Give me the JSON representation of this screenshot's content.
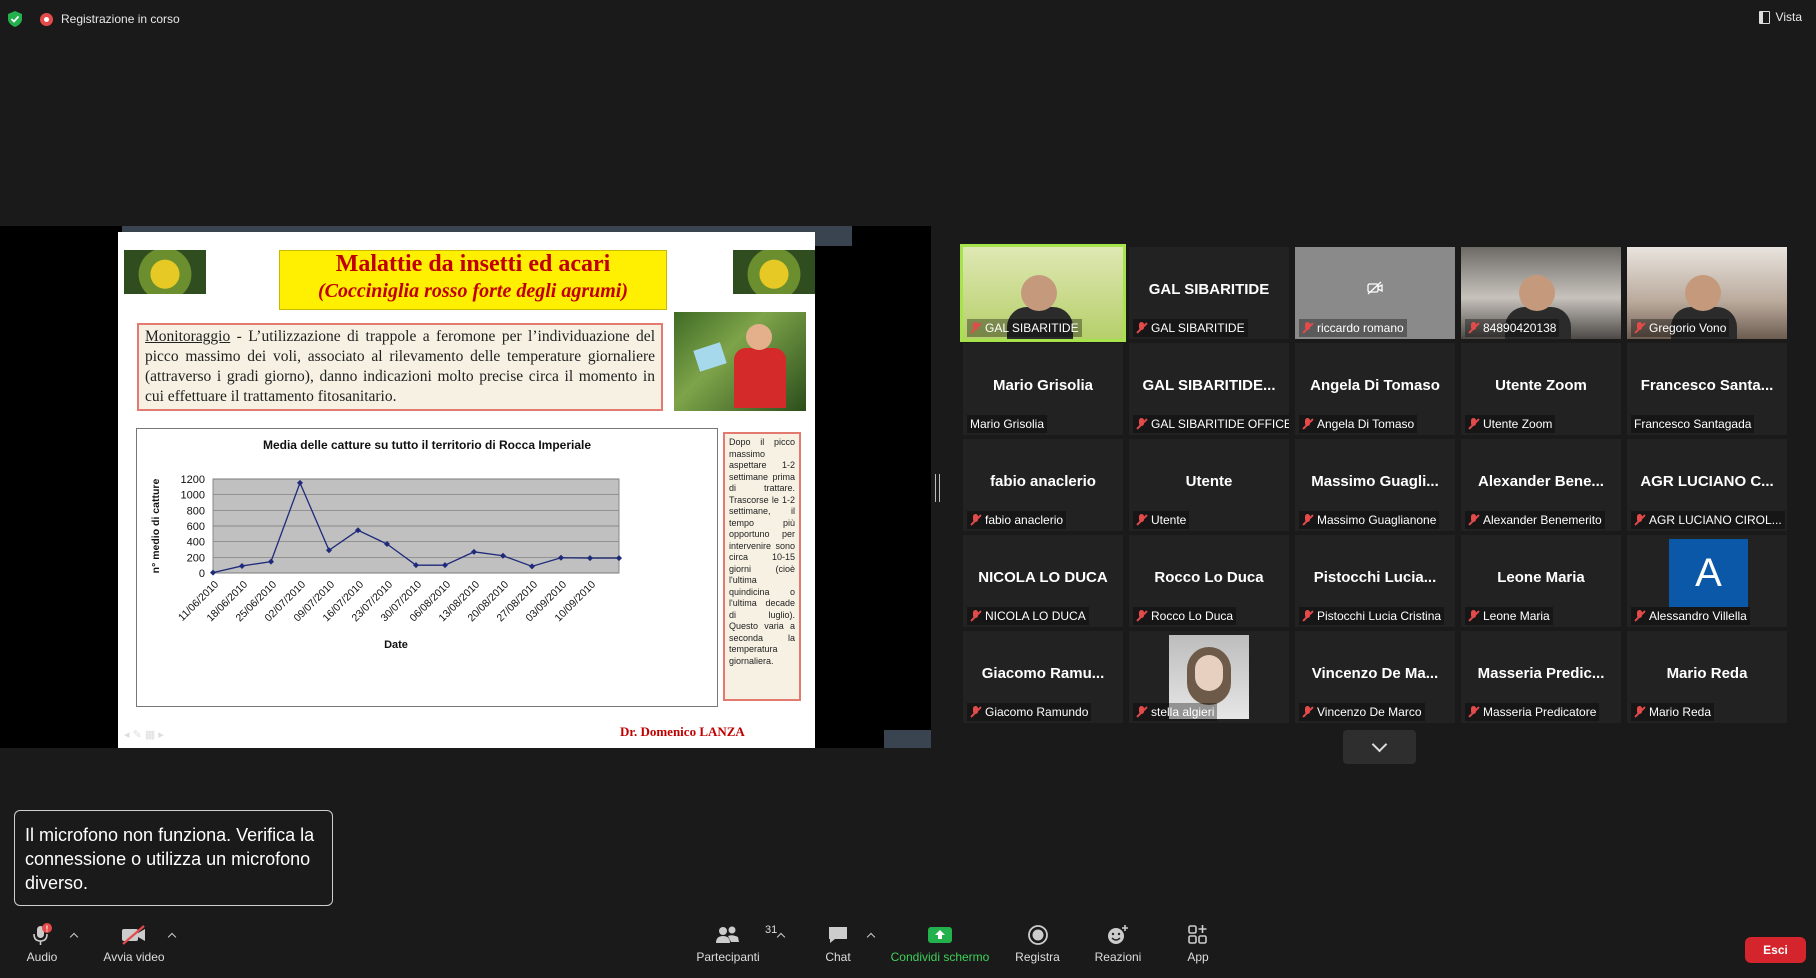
{
  "topbar": {
    "recording_label": "Registrazione in corso",
    "view_label": "Vista"
  },
  "slide": {
    "title_line1": "Malattie da insetti ed acari",
    "title_line2": "(Cocciniglia rosso forte degli agrumi)",
    "monitor_label": "Monitoraggio",
    "monitor_text": " - L’utilizzazione di trappole a feromone per l’individuazione del picco massimo dei voli, associato al rilevamento delle temperature giornaliere (attraverso i gradi giorno), danno indicazioni molto precise circa il momento in cui effettuare il trattamento fitosanitario.",
    "side_note": "Dopo il picco massimo aspettare 1-2 settimane prima di trattare. Trascorse le 1-2 settimane, il tempo più opportuno per intervenire sono circa 10-15 giorni (cioè l'ultima quindicina o l'ultima decade di luglio). Questo varia a seconda la temperatura giornaliera.",
    "author": "Dr. Domenico LANZA"
  },
  "chart_data": {
    "type": "line",
    "title": "Media delle catture su tutto il territorio di Rocca Imperiale",
    "xlabel": "Date",
    "ylabel": "n° medio di catture",
    "ylim": [
      0,
      1200
    ],
    "yticks": [
      0,
      200,
      400,
      600,
      800,
      1000,
      1200
    ],
    "grid": true,
    "x_tick_labels": [
      "11/06/2010",
      "18/06/2010",
      "25/06/2010",
      "02/07/2010",
      "09/07/2010",
      "16/07/2010",
      "23/07/2010",
      "30/07/2010",
      "06/08/2010",
      "13/08/2010",
      "20/08/2010",
      "27/08/2010",
      "03/09/2010",
      "10/09/2010"
    ],
    "series": [
      {
        "name": "",
        "x_index": [
          0,
          1,
          2,
          3,
          4,
          5,
          6,
          7,
          8,
          9,
          10,
          11,
          12,
          13,
          14
        ],
        "values": [
          5,
          90,
          145,
          1150,
          290,
          545,
          370,
          100,
          100,
          270,
          220,
          85,
          195,
          190,
          190
        ]
      }
    ],
    "colors": {
      "line": "#1f2a7a",
      "plot_bg": "#c0c0c0"
    }
  },
  "participants": [
    {
      "name": "GAL SIBARITIDE",
      "label": "GAL SIBARITIDE",
      "type": "video",
      "mic": "muted",
      "active": true
    },
    {
      "name": "GAL SIBARITIDE",
      "label": "GAL SIBARITIDE",
      "type": "name",
      "mic": "muted"
    },
    {
      "name": "",
      "label": "riccardo romano",
      "type": "video-off",
      "mic": "muted"
    },
    {
      "name": "",
      "label": "84890420138",
      "type": "video",
      "mic": "muted"
    },
    {
      "name": "",
      "label": "Gregorio Vono",
      "type": "video",
      "mic": "muted"
    },
    {
      "name": "Mario Grisolia",
      "label": "Mario Grisolia",
      "type": "name",
      "mic": "none"
    },
    {
      "name": "GAL SIBARITIDE...",
      "label": "GAL SIBARITIDE OFFICE",
      "type": "name",
      "mic": "muted"
    },
    {
      "name": "Angela Di Tomaso",
      "label": "Angela Di Tomaso",
      "type": "name",
      "mic": "muted"
    },
    {
      "name": "Utente Zoom",
      "label": "Utente Zoom",
      "type": "name",
      "mic": "muted"
    },
    {
      "name": "Francesco  Santa...",
      "label": "Francesco Santagada",
      "type": "name",
      "mic": "none"
    },
    {
      "name": "fabio anaclerio",
      "label": "fabio anaclerio",
      "type": "name",
      "mic": "muted"
    },
    {
      "name": "Utente",
      "label": "Utente",
      "type": "name",
      "mic": "muted"
    },
    {
      "name": "Massimo  Guagli...",
      "label": "Massimo Guaglianone",
      "type": "name",
      "mic": "muted"
    },
    {
      "name": "Alexander  Bene...",
      "label": "Alexander Benemerito",
      "type": "name",
      "mic": "muted"
    },
    {
      "name": "AGR LUCIANO C...",
      "label": "AGR LUCIANO CIROL...",
      "type": "name",
      "mic": "muted"
    },
    {
      "name": "NICOLA LO DUCA",
      "label": "NICOLA LO DUCA",
      "type": "name",
      "mic": "muted"
    },
    {
      "name": "Rocco Lo Duca",
      "label": "Rocco Lo Duca",
      "type": "name",
      "mic": "muted"
    },
    {
      "name": "Pistocchi  Lucia...",
      "label": "Pistocchi Lucia Cristina",
      "type": "name",
      "mic": "muted"
    },
    {
      "name": "Leone Maria",
      "label": "Leone Maria",
      "type": "name",
      "mic": "muted"
    },
    {
      "name": "A",
      "label": "Alessandro Villella",
      "type": "avatar",
      "mic": "muted"
    },
    {
      "name": "Giacomo  Ramu...",
      "label": "Giacomo Ramundo",
      "type": "name",
      "mic": "muted"
    },
    {
      "name": "",
      "label": "stella algieri",
      "type": "photo",
      "mic": "muted"
    },
    {
      "name": "Vincenzo  De  Ma...",
      "label": "Vincenzo De Marco",
      "type": "name",
      "mic": "muted"
    },
    {
      "name": "Masseria  Predic...",
      "label": "Masseria Predicatore",
      "type": "name",
      "mic": "muted"
    },
    {
      "name": "Mario Reda",
      "label": "Mario Reda",
      "type": "name",
      "mic": "muted"
    }
  ],
  "toast": {
    "text": "Il microfono non funziona. Verifica la connessione o utilizza un microfono diverso."
  },
  "toolbar": {
    "audio": "Audio",
    "video": "Avvia video",
    "participants": "Partecipanti",
    "participants_count": "31",
    "chat": "Chat",
    "share": "Condividi schermo",
    "record": "Registra",
    "reactions": "Reazioni",
    "apps": "App",
    "leave": "Esci"
  }
}
